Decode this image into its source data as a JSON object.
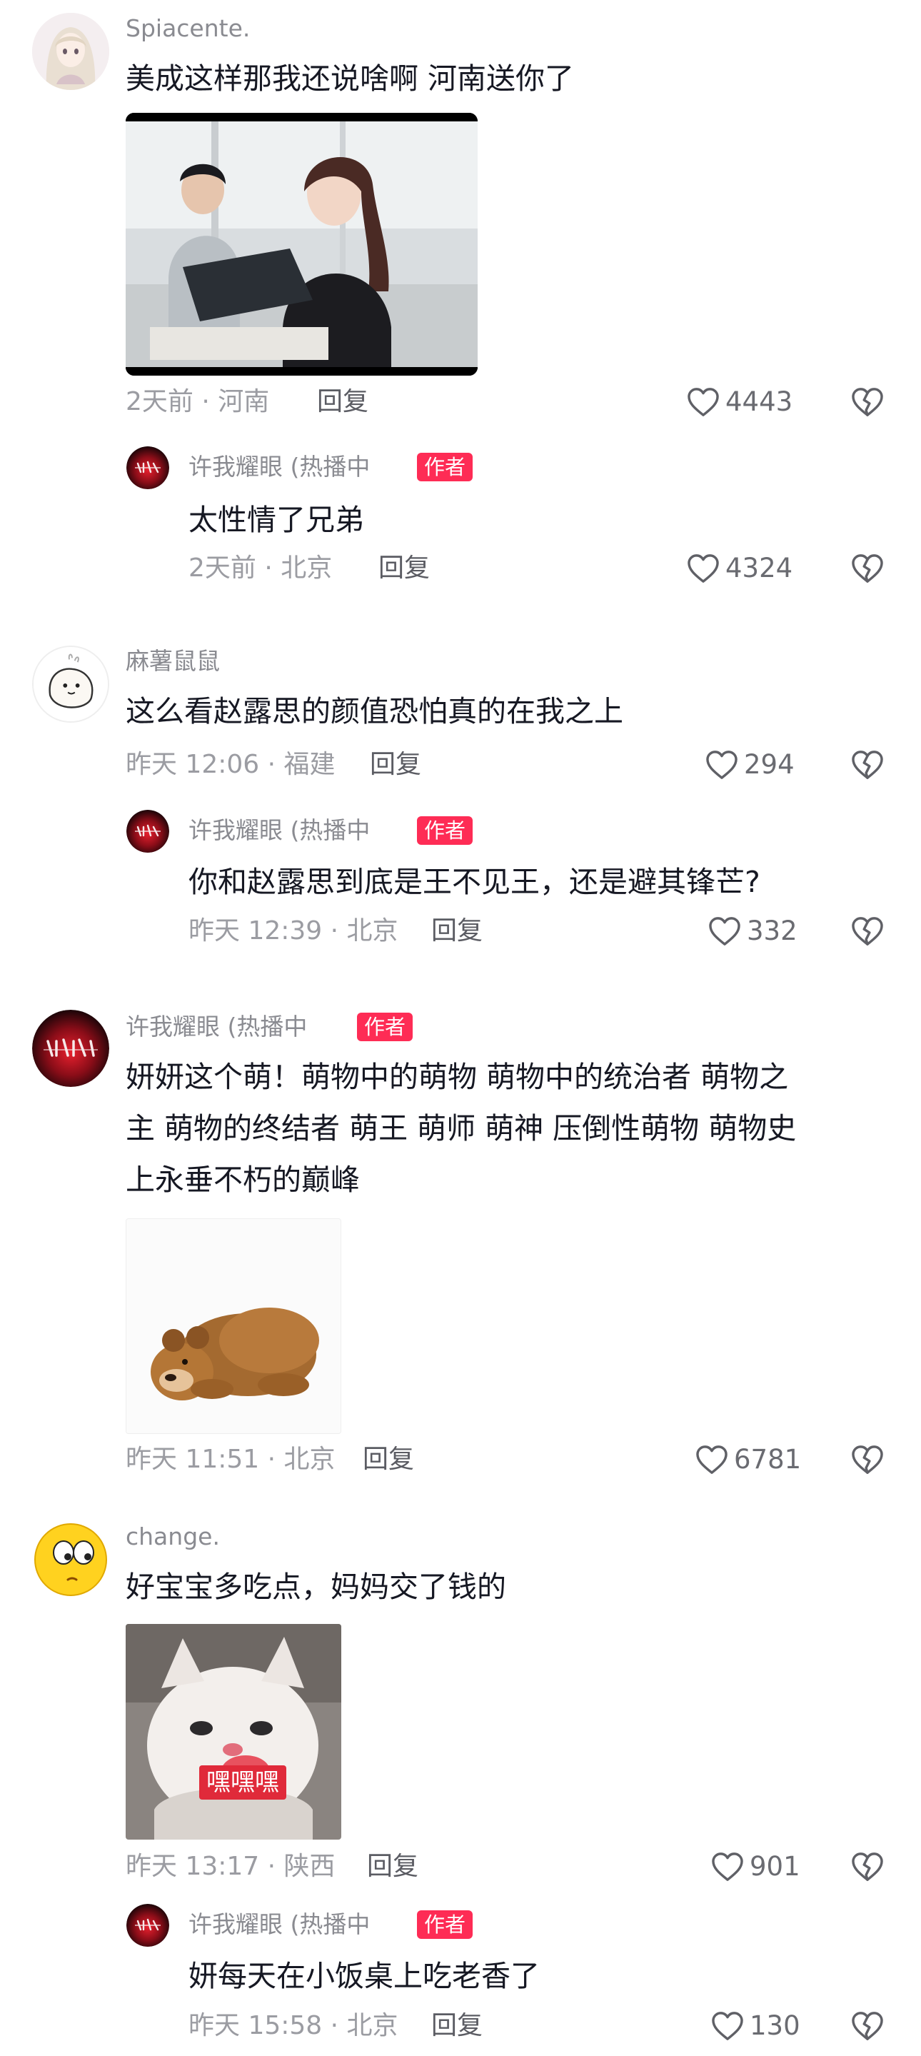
{
  "comments": [
    {
      "user": "Spiacente.",
      "text": "美成这样那我还说啥啊 河南送你了",
      "meta": "2天前 · 河南",
      "reply_label": "回复",
      "likes": "4443",
      "reply": {
        "user": "许我耀眼 (热播中",
        "badge": "作者",
        "text": "太性情了兄弟",
        "meta": "2天前 · 北京",
        "reply_label": "回复",
        "likes": "4324"
      }
    },
    {
      "user": "麻薯鼠鼠",
      "text": "这么看赵露思的颜值恐怕真的在我之上",
      "meta": "昨天 12:06 · 福建",
      "reply_label": "回复",
      "likes": "294",
      "reply": {
        "user": "许我耀眼 (热播中",
        "badge": "作者",
        "text": "你和赵露思到底是王不见王，还是避其锋芒?",
        "meta": "昨天 12:39 · 北京",
        "reply_label": "回复",
        "likes": "332"
      }
    },
    {
      "user": "许我耀眼 (热播中",
      "badge": "作者",
      "text_lines": [
        "妍妍这个萌！萌物中的萌物 萌物中的统治者 萌物之",
        "主 萌物的终结者 萌王 萌师 萌神 压倒性萌物 萌物史",
        "上永垂不朽的巅峰"
      ],
      "meta": "昨天 11:51 · 北京",
      "reply_label": "回复",
      "likes": "6781"
    },
    {
      "user": "change.",
      "text": "好宝宝多吃点，妈妈交了钱的",
      "sticker_caption": "嘿嘿嘿",
      "meta": "昨天 13:17 · 陕西",
      "reply_label": "回复",
      "likes": "901",
      "reply": {
        "user": "许我耀眼 (热播中",
        "badge": "作者",
        "text": "妍每天在小饭桌上吃老香了",
        "meta": "昨天 15:58 · 北京",
        "reply_label": "回复",
        "likes": "130"
      }
    }
  ],
  "icons": {
    "like": "heart-outline-icon",
    "dislike": "broken-heart-icon"
  },
  "colors": {
    "author_badge": "#fe2c55",
    "text": "#161823",
    "meta": "#9b9ca2"
  }
}
